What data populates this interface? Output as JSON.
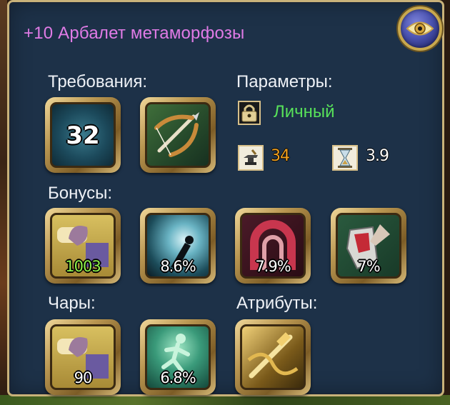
{
  "item": {
    "title": "+10 Арбалет метаморфозы"
  },
  "sections": {
    "requirements": "Требования:",
    "parameters": "Параметры:",
    "bonuses": "Бонусы:",
    "enchants": "Чары:",
    "attributes": "Атрибуты:"
  },
  "requirements": [
    {
      "icon": "level-badge-icon",
      "value": "32"
    },
    {
      "icon": "crossbow-class-icon",
      "value": ""
    }
  ],
  "parameters": {
    "binding": {
      "icon": "padlock-icon",
      "text": "Личный"
    },
    "stats": [
      {
        "icon": "anvil-icon",
        "value": "34",
        "color": "#f0a020"
      },
      {
        "icon": "hourglass-icon",
        "value": "3.9",
        "color": "#ffffff"
      }
    ]
  },
  "bonuses": [
    {
      "icon": "strength-arm-icon",
      "value": "1003",
      "color": "#8ef24a"
    },
    {
      "icon": "slash-swirl-icon",
      "value": "8.6%",
      "color": "#ffffff"
    },
    {
      "icon": "red-ring-icon",
      "value": "7.9%",
      "color": "#ffffff"
    },
    {
      "icon": "armor-pierce-icon",
      "value": "7%",
      "color": "#ffffff"
    }
  ],
  "enchants": [
    {
      "icon": "strength-arm-icon",
      "value": "90"
    },
    {
      "icon": "running-figure-icon",
      "value": "6.8%"
    }
  ],
  "attributes": [
    {
      "icon": "golden-crossbow-icon",
      "value": ""
    }
  ],
  "colors": {
    "panel": "#1d3148",
    "border": "#c9b27a",
    "title": "#e07be6",
    "personal": "#58e25a",
    "label": "#eef1f6"
  }
}
